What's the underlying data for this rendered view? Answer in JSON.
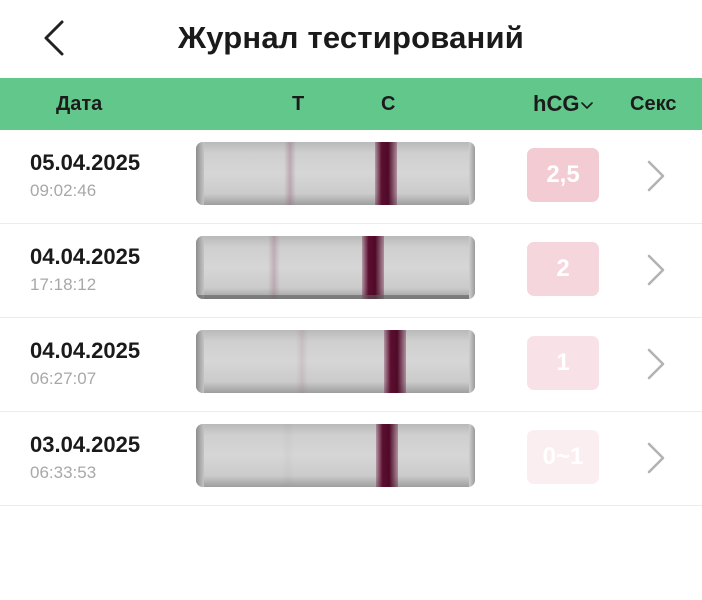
{
  "header": {
    "title": "Журнал тестирований",
    "back_icon": "chevron-left-icon"
  },
  "columns": {
    "date": "Дата",
    "t": "T",
    "c": "C",
    "hcg": "hCG",
    "hcg_sort_icon": "chevron-down-icon",
    "sex": "Секс"
  },
  "colors": {
    "header_bg": "#62c78b",
    "control_line": "#5c0e30",
    "badge_levels": [
      "#f2cbd3",
      "#f5d6dd",
      "#f8e2e7",
      "#fbeef1"
    ]
  },
  "rows": [
    {
      "date": "05.04.2025",
      "time": "09:02:46",
      "hcg": "2,5",
      "t_line_strength": 0.35
    },
    {
      "date": "04.04.2025",
      "time": "17:18:12",
      "hcg": "2",
      "t_line_strength": 0.3
    },
    {
      "date": "04.04.2025",
      "time": "06:27:07",
      "hcg": "1",
      "t_line_strength": 0.15
    },
    {
      "date": "03.04.2025",
      "time": "06:33:53",
      "hcg": "0~1",
      "t_line_strength": 0.05
    }
  ]
}
